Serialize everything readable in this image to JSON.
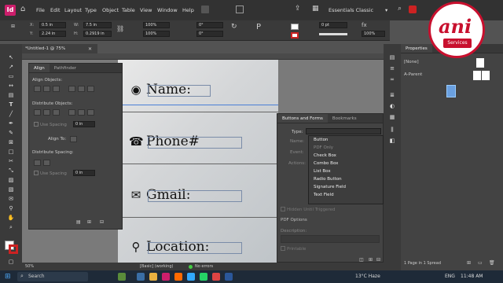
{
  "menubar": {
    "app_logo": "Id",
    "items": [
      "File",
      "Edit",
      "Layout",
      "Type",
      "Object",
      "Table",
      "View",
      "Window",
      "Help"
    ],
    "workspace": "Essentials Classic"
  },
  "controlbar": {
    "x_label": "X:",
    "x_value": "0.5 in",
    "y_label": "Y:",
    "y_value": "2.24 in",
    "w_label": "W:",
    "w_value": "7.5 in",
    "h_label": "H:",
    "h_value": "0.2919 in",
    "scale_x": "100%",
    "scale_y": "100%",
    "rotate": "0°",
    "shear": "0°",
    "stroke_weight": "0 pt",
    "opacity": "100%"
  },
  "document": {
    "tab_label": "*Untitled-1 @ 75%",
    "zoom": "75%"
  },
  "align_panel": {
    "tab_align": "Align",
    "tab_pathfinder": "Pathfinder",
    "align_objects": "Align Objects:",
    "distribute_objects": "Distribute Objects:",
    "use_spacing": "Use Spacing",
    "spacing_value": "0 in",
    "align_to": "Align To:",
    "distribute_spacing": "Distribute Spacing:",
    "use_spacing2": "Use Spacing",
    "spacing_value2": "0 in"
  },
  "form": {
    "name": "Name:",
    "phone": "Phone#",
    "gmail": "Gmail:",
    "location": "Location:"
  },
  "bf_panel": {
    "tab_buttons": "Buttons and Forms",
    "tab_bookmarks": "Bookmarks",
    "type_label": "Type:",
    "name_label": "Name:",
    "event_label": "Event:",
    "actions_label": "Actions:",
    "hidden_until": "Hidden Until Triggered",
    "pdf_options": "PDF Options",
    "description": "Description:",
    "printable": "Printable",
    "options": [
      "Button",
      "PDF Only",
      "Check Box",
      "Combo Box",
      "List Box",
      "Radio Button",
      "Signature Field",
      "Text Field"
    ],
    "selected_option": "Button"
  },
  "props": {
    "tab_properties": "Properties",
    "none_swatch": "[None]",
    "a_parent": "A-Parent",
    "pages_status": "1 Page in 1 Spread"
  },
  "statusbar": {
    "zoom": "50%",
    "style": "[Basic] (working)",
    "errors": "No errors"
  },
  "taskbar": {
    "search": "Search",
    "weather": "13°C  Haze",
    "lang": "ENG",
    "time": "11:48 AM"
  },
  "brand": {
    "name": "ani",
    "tagline": "Services"
  },
  "colors": {
    "accent": "#cc1e6b",
    "brand_red": "#c8102e",
    "frame_blue": "#4a7fd6"
  }
}
